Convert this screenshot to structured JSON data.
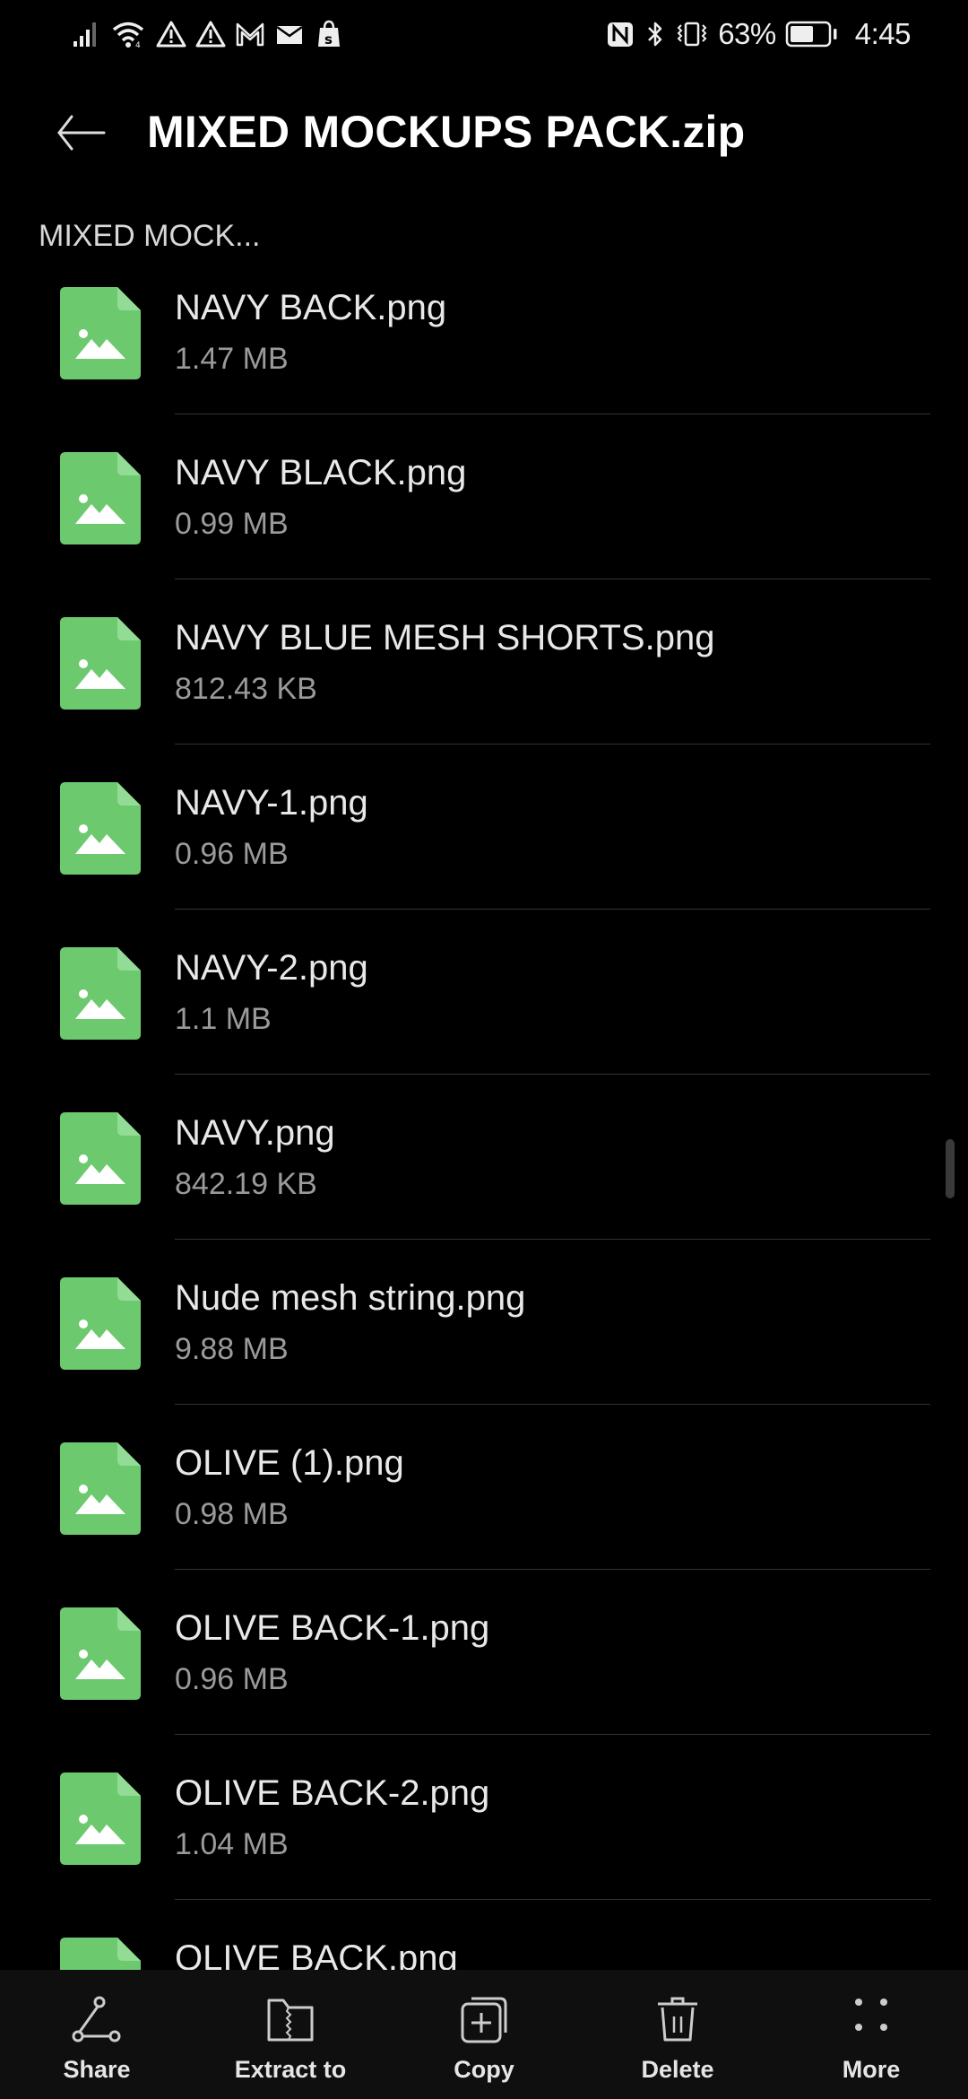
{
  "status_bar": {
    "left_icons": [
      "signal-icon",
      "wifi-icon",
      "alert-icon",
      "alert-icon",
      "gmail-icon",
      "mail-icon",
      "shopify-icon"
    ],
    "right_icons": [
      "nfc-icon",
      "bluetooth-icon",
      "vibrate-icon"
    ],
    "battery_percent_text": "63%",
    "battery_level": 0.63,
    "time": "4:45"
  },
  "header": {
    "title": "MIXED MOCKUPS PACK.zip",
    "back_icon": "arrow-left-icon"
  },
  "breadcrumb": "MIXED MOCK...",
  "files": [
    {
      "name": "NAVY BACK.png",
      "size": "1.47 MB"
    },
    {
      "name": "NAVY BLACK.png",
      "size": "0.99 MB"
    },
    {
      "name": "NAVY BLUE MESH SHORTS.png",
      "size": "812.43 KB"
    },
    {
      "name": "NAVY-1.png",
      "size": "0.96 MB"
    },
    {
      "name": "NAVY-2.png",
      "size": "1.1 MB"
    },
    {
      "name": "NAVY.png",
      "size": "842.19 KB"
    },
    {
      "name": "Nude mesh string.png",
      "size": "9.88 MB"
    },
    {
      "name": "OLIVE (1).png",
      "size": "0.98 MB"
    },
    {
      "name": "OLIVE BACK-1.png",
      "size": "0.96 MB"
    },
    {
      "name": "OLIVE BACK-2.png",
      "size": "1.04 MB"
    },
    {
      "name": "OLIVE BACK.png",
      "size": ""
    }
  ],
  "colors": {
    "file_icon": "#6cc96e",
    "file_icon_fold": "#93dc95",
    "background": "#000000",
    "bottom_bar": "#0f0f0f"
  },
  "bottom_actions": [
    {
      "label": "Share",
      "icon": "share-icon"
    },
    {
      "label": "Extract to",
      "icon": "extract-folder-icon"
    },
    {
      "label": "Copy",
      "icon": "copy-icon"
    },
    {
      "label": "Delete",
      "icon": "trash-icon"
    },
    {
      "label": "More",
      "icon": "more-dots-icon"
    }
  ]
}
